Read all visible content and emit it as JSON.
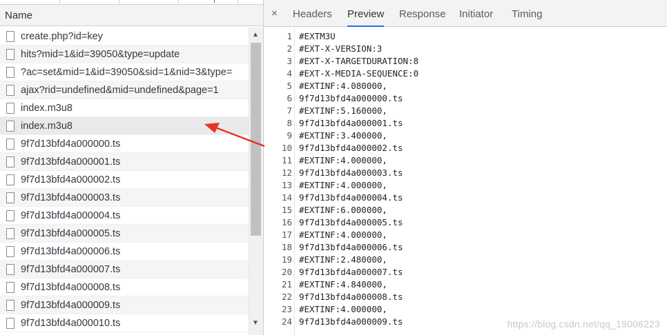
{
  "list": {
    "header": "Name",
    "items": [
      "create.php?id=key",
      "hits?mid=1&id=39050&type=update",
      "?ac=set&mid=1&id=39050&sid=1&nid=3&type=",
      "ajax?rid=undefined&mid=undefined&page=1",
      "index.m3u8",
      "index.m3u8",
      "9f7d13bfd4a000000.ts",
      "9f7d13bfd4a000001.ts",
      "9f7d13bfd4a000002.ts",
      "9f7d13bfd4a000003.ts",
      "9f7d13bfd4a000004.ts",
      "9f7d13bfd4a000005.ts",
      "9f7d13bfd4a000006.ts",
      "9f7d13bfd4a000007.ts",
      "9f7d13bfd4a000008.ts",
      "9f7d13bfd4a000009.ts",
      "9f7d13bfd4a000010.ts"
    ],
    "selected_index": 5
  },
  "detail": {
    "close_icon": "close-icon",
    "close_glyph": "×",
    "tabs": [
      "Headers",
      "Preview",
      "Response",
      "Initiator",
      "Timing"
    ],
    "active_tab": "Preview",
    "preview_lines": [
      "#EXTM3U",
      "#EXT-X-VERSION:3",
      "#EXT-X-TARGETDURATION:8",
      "#EXT-X-MEDIA-SEQUENCE:0",
      "#EXTINF:4.080000,",
      "9f7d13bfd4a000000.ts",
      "#EXTINF:5.160000,",
      "9f7d13bfd4a000001.ts",
      "#EXTINF:3.400000,",
      "9f7d13bfd4a000002.ts",
      "#EXTINF:4.000000,",
      "9f7d13bfd4a000003.ts",
      "#EXTINF:4.000000,",
      "9f7d13bfd4a000004.ts",
      "#EXTINF:6.000000,",
      "9f7d13bfd4a000005.ts",
      "#EXTINF:4.000000,",
      "9f7d13bfd4a000006.ts",
      "#EXTINF:2.480000,",
      "9f7d13bfd4a000007.ts",
      "#EXTINF:4.840000,",
      "9f7d13bfd4a000008.ts",
      "#EXTINF:4.000000,",
      "9f7d13bfd4a000009.ts"
    ]
  },
  "watermark": "https://blog.csdn.net/qq_19006223",
  "colors": {
    "accent": "#1a73e8",
    "annotation_arrow": "#e8352b",
    "selected_row": "#eaeaea"
  }
}
